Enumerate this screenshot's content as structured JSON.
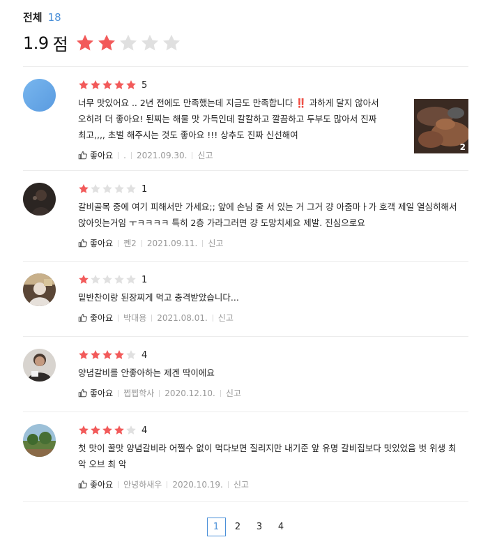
{
  "header": {
    "total_label": "전체",
    "total_count": "18"
  },
  "summary": {
    "score": "1.9",
    "unit": "점",
    "rating": 2,
    "max_rating": 5
  },
  "colors": {
    "star_on": "#f25a5a",
    "star_off": "#e0e0e0",
    "accent": "#4a8fd8"
  },
  "reviews": [
    {
      "rating": 5,
      "rating_label": "5",
      "text": "너무 맛있어요 .. 2년 전에도 만족했는데 지금도 만족합니다 ‼️  과하게 달지 않아서 오히려 더 좋아요! 된찌는 해물 맛 가득인데 칼칼하고 깔끔하고 두부도 많아서 진짜 최고,,,, 초벌 해주시는 것도 좋아요 !!! 상추도 진짜 신선해여",
      "like_label": "좋아요",
      "author": ".",
      "date": "2021.09.30.",
      "report_label": "신고",
      "photo_count": "2"
    },
    {
      "rating": 1,
      "rating_label": "1",
      "text": "갈비골목 중에 여기 피해서만 가세요;; 앞에 손님 줄 서 있는 거 그거 걍 아줌마ㅏ가 호객 제일 열심히해서 앉아잇는거임 ㅜㅋㅋㅋㅋ 특히 2층 가라그러면 걍 도망치세요 제발. 진심으로요",
      "like_label": "좋아요",
      "author": "쩬2",
      "date": "2021.09.11.",
      "report_label": "신고"
    },
    {
      "rating": 1,
      "rating_label": "1",
      "text": "밑반찬이랑 된장찌게 먹고 충격받았습니다...",
      "like_label": "좋아요",
      "author": "박대용",
      "date": "2021.08.01.",
      "report_label": "신고"
    },
    {
      "rating": 4,
      "rating_label": "4",
      "text": "양념갈비를 안좋아하는 제겐 딱이에요",
      "like_label": "좋아요",
      "author": "쩝쩝학사",
      "date": "2020.12.10.",
      "report_label": "신고"
    },
    {
      "rating": 4,
      "rating_label": "4",
      "text": "첫 맛이 꿀맛 양념갈비라 어쩔수 없이 먹다보면 질리지만 내기준 앞 유명 갈비집보다 밋있었음 벗 위생 최 악 오브 최 악",
      "like_label": "좋아요",
      "author": "안녕하새우",
      "date": "2020.10.19.",
      "report_label": "신고"
    }
  ],
  "pagination": {
    "pages": [
      "1",
      "2",
      "3",
      "4"
    ],
    "current": "1"
  }
}
